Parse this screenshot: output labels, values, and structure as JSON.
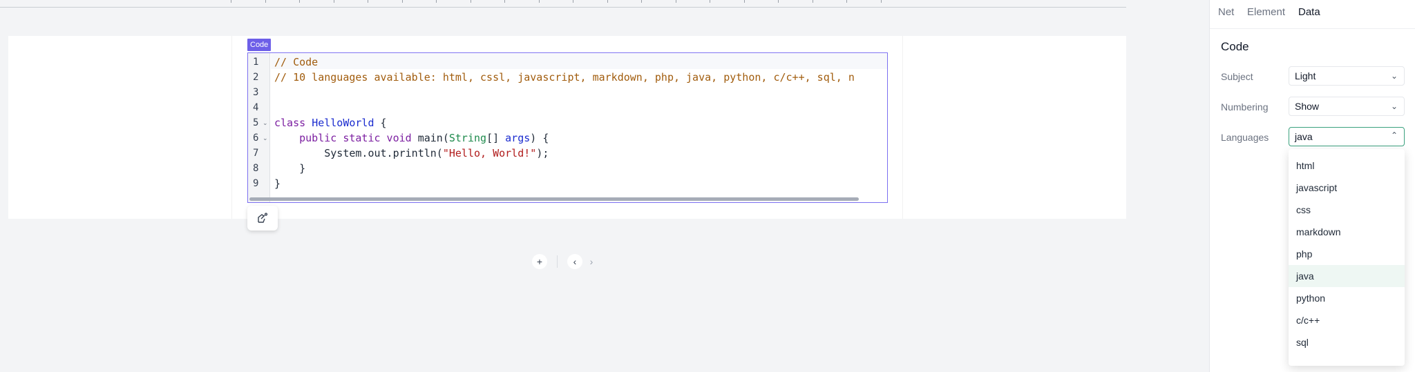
{
  "editor": {
    "block_label": "Code",
    "lines": [
      {
        "num": "1",
        "fold": ""
      },
      {
        "num": "2",
        "fold": ""
      },
      {
        "num": "3",
        "fold": ""
      },
      {
        "num": "4",
        "fold": ""
      },
      {
        "num": "5",
        "fold": "⌄"
      },
      {
        "num": "6",
        "fold": "⌄"
      },
      {
        "num": "7",
        "fold": ""
      },
      {
        "num": "8",
        "fold": ""
      },
      {
        "num": "9",
        "fold": ""
      }
    ],
    "code": {
      "l1": "// Code",
      "l2": "// 10 languages available: html, cssl, javascript, markdown, php, java, python, c/c++, sql, n",
      "l5_kw": "class",
      "l5_name": "HelloWorld",
      "l5_rest": " {",
      "l6_indent": "    ",
      "l6_kw": "public static void",
      "l6_fn": " main(",
      "l6_type": "String",
      "l6_mid": "[] ",
      "l6_var": "args",
      "l6_end": ") {",
      "l7_pre": "        System.out.println(",
      "l7_str": "\"Hello, World!\"",
      "l7_end": ");",
      "l8": "    }",
      "l9": "}"
    }
  },
  "toolbar": {
    "add_label": "+",
    "prev_label": "‹",
    "next_label": "›"
  },
  "panel": {
    "tabs": [
      "Net",
      "Element",
      "Data"
    ],
    "active_tab": "Data",
    "title": "Code",
    "fields": {
      "subject": {
        "label": "Subject",
        "value": "Light"
      },
      "numbering": {
        "label": "Numbering",
        "value": "Show"
      },
      "languages": {
        "label": "Languages",
        "value": "java"
      }
    },
    "language_options": [
      "html",
      "javascript",
      "css",
      "markdown",
      "php",
      "java",
      "python",
      "c/c++",
      "sql"
    ],
    "selected_language": "java"
  },
  "colors": {
    "accent_purple": "#6d5fe8",
    "accent_green": "#3aa17e"
  }
}
